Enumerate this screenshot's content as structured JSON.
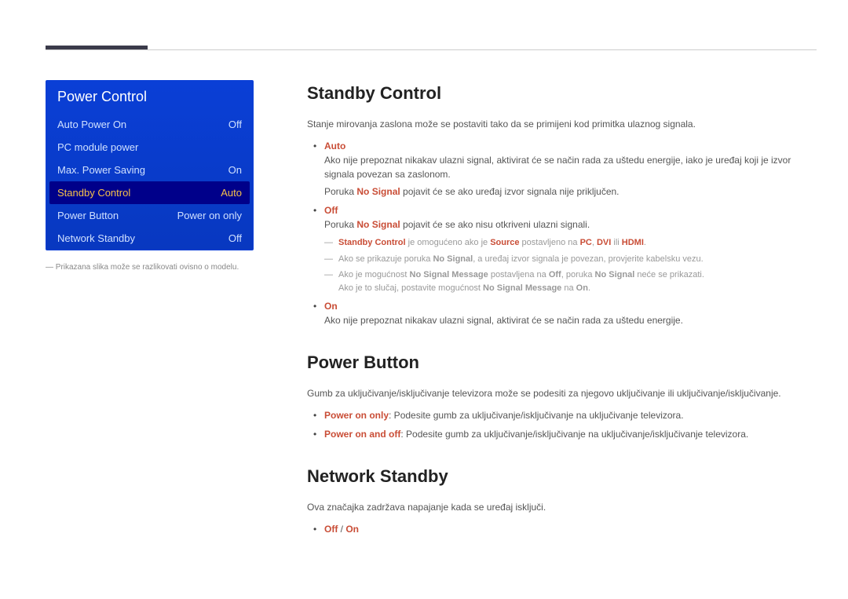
{
  "menu": {
    "title": "Power Control",
    "items": [
      {
        "label": "Auto Power On",
        "value": "Off",
        "selected": false
      },
      {
        "label": "PC module power",
        "value": "",
        "selected": false
      },
      {
        "label": "Max. Power Saving",
        "value": "On",
        "selected": false
      },
      {
        "label": "Standby Control",
        "value": "Auto",
        "selected": true
      },
      {
        "label": "Power Button",
        "value": "Power on only",
        "selected": false
      },
      {
        "label": "Network Standby",
        "value": "Off",
        "selected": false
      }
    ],
    "footnote": "― Prikazana slika može se razlikovati ovisno o modelu."
  },
  "sections": {
    "standby": {
      "heading": "Standby Control",
      "intro": "Stanje mirovanja zaslona može se postaviti tako da se primijeni kod primitka ulaznog signala.",
      "opt_auto": "Auto",
      "auto_l1a": "Ako nije prepoznat nikakav ulazni signal, aktivirat će se način rada za uštedu energije, iako je uređaj koji je izvor signala povezan sa zaslonom.",
      "auto_l2a": "Poruka ",
      "auto_l2b": "No Signal",
      "auto_l2c": " pojavit će se ako uređaj izvor signala nije priključen.",
      "opt_off": "Off",
      "off_l1a": "Poruka ",
      "off_l1b": "No Signal",
      "off_l1c": " pojavit će se ako nisu otkriveni ulazni signali.",
      "sub1_a": "Standby Control",
      "sub1_b": " je omogućeno ako je ",
      "sub1_c": "Source",
      "sub1_d": " postavljeno na ",
      "sub1_e": "PC",
      "sub1_f": ", ",
      "sub1_g": "DVI",
      "sub1_h": " ili ",
      "sub1_i": "HDMI",
      "sub1_j": ".",
      "sub2_a": "Ako se prikazuje poruka ",
      "sub2_b": "No Signal",
      "sub2_c": ", a uređaj izvor signala je povezan, provjerite kabelsku vezu.",
      "sub3_a": "Ako je mogućnost ",
      "sub3_b": "No Signal Message",
      "sub3_c": " postavljena na ",
      "sub3_d": "Off",
      "sub3_e": ", poruka ",
      "sub3_f": "No Signal",
      "sub3_g": " neće se prikazati.",
      "sub3_h": "Ako je to slučaj, postavite mogućnost ",
      "sub3_i": "No Signal Message",
      "sub3_j": " na ",
      "sub3_k": "On",
      "sub3_l": ".",
      "opt_on": "On",
      "on_l1": "Ako nije prepoznat nikakav ulazni signal, aktivirat će se način rada za uštedu energije."
    },
    "powerbtn": {
      "heading": "Power Button",
      "intro": "Gumb za uključivanje/isključivanje televizora može se podesiti za njegovo uključivanje ili uključivanje/isključivanje.",
      "opt1_label": "Power on only",
      "opt1_text": ": Podesite gumb za uključivanje/isključivanje na uključivanje televizora.",
      "opt2_label": "Power on and off",
      "opt2_text": ": Podesite gumb za uključivanje/isključivanje na uključivanje/isključivanje televizora."
    },
    "netstandby": {
      "heading": "Network Standby",
      "intro": "Ova značajka zadržava napajanje kada se uređaj isključi.",
      "off": "Off",
      "slash": " / ",
      "on": "On"
    }
  }
}
